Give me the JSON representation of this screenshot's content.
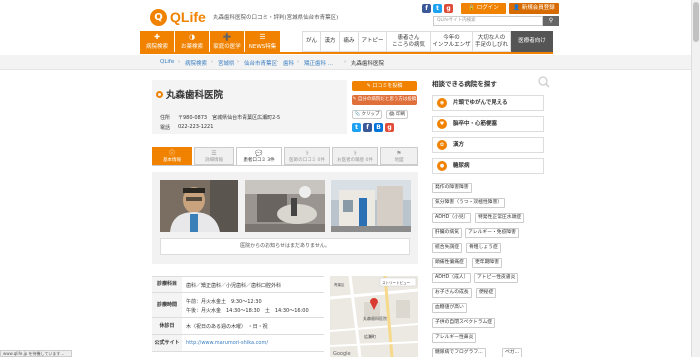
{
  "header": {
    "logo_text": "QLife",
    "logo_mark": "Q",
    "tagline": "丸森歯科医院の口コミ・評判(宮城県仙台市青葉区)",
    "login_label": "ログイン",
    "register_label": "新規会員登録",
    "search_placeholder": "QLifeサイト内検索",
    "search_icon": "search-icon",
    "accent_color": "#f08200"
  },
  "nav": {
    "items": [
      {
        "label": "病院検索",
        "icon": "hospital-icon"
      },
      {
        "label": "お薬検索",
        "icon": "pill-icon"
      },
      {
        "label": "家庭の医学",
        "icon": "cross-icon"
      },
      {
        "label": "NEWS特集",
        "icon": "news-icon"
      },
      {
        "label": "がん"
      },
      {
        "label": "漢方"
      },
      {
        "label": "痛み"
      },
      {
        "label": "アトピー"
      },
      {
        "label": "患者さん",
        "label2": "こころの病気"
      },
      {
        "label": "今年の",
        "label2": "インフルエンザ"
      },
      {
        "label": "大切な人の",
        "label2": "手足のしびれ"
      },
      {
        "label": "医療者向け"
      }
    ]
  },
  "breadcrumb": [
    "QLife",
    "病院検索",
    "宮城県",
    "仙台市青葉区",
    "歯科",
    "矯正歯科 ..."
  ],
  "breadcrumb_current": "丸森歯科医院",
  "clinic": {
    "name": "丸森歯科医院",
    "address_label": "住所",
    "address": "〒980-0873　宮城県仙台市青葉区広瀬町2-5",
    "phone_label": "電話",
    "phone": "022-223-1221",
    "post_review": "口コミを投稿",
    "add_photo": "自分の病院だと思う方は投稿",
    "clip": "クリップ",
    "print": "印刷"
  },
  "tabs": [
    {
      "label": "基本情報"
    },
    {
      "label": "詳細情報"
    },
    {
      "label": "患者口コミ 3件"
    },
    {
      "label": "医師の口コミ 0件"
    },
    {
      "label": "お医者の職歴 0件"
    },
    {
      "label": "地図"
    }
  ],
  "notice": "医院からのお知らせはまだありません。",
  "details": [
    {
      "label": "診療科目",
      "lines": [
        "歯科／矯正歯科／小児歯科／歯科口腔外科"
      ]
    },
    {
      "label": "診療時間",
      "lines": [
        "午前：月火水金土　9:30〜12:30",
        "午後：月火水金　14:30〜18:30　土　14:30〜16:00"
      ]
    },
    {
      "label": "休診日",
      "lines": [
        "木（祝日のある週の木曜） ・日・祝"
      ]
    },
    {
      "label": "公式サイト",
      "lines": [
        "http://www.marumori-shika.com/"
      ]
    }
  ],
  "map": {
    "labels": [
      "広瀬町",
      "青葉区",
      "丸森歯科医院",
      "ストリートビュー",
      "Google"
    ]
  },
  "sidebar": {
    "heading": "相談できる病院を探す",
    "buttons": [
      {
        "label": "片頭でゆがんで見える",
        "icon": "eye-icon"
      },
      {
        "label": "脳卒中・心筋梗塞",
        "icon": "heart-icon"
      },
      {
        "label": "漢方",
        "icon": "herb-icon"
      },
      {
        "label": "糖尿病",
        "icon": "drop-icon"
      }
    ],
    "tags": [
      [
        "発作の障害障害"
      ],
      [
        "気分障害（うつ・双極性障害）"
      ],
      [
        "ADHD（小児）",
        "特発性正常圧水頭症"
      ],
      [
        "肝臓の病気",
        "アレルギー・免疫障害"
      ],
      [
        "統合失調症",
        "骨粗しょう症"
      ],
      [
        "頭痛性偏痛症",
        "更年期障害"
      ],
      [
        "ADHD（成人）",
        "アトピー性皮膚炎"
      ],
      [
        "お子さんの成長",
        "便秘症"
      ],
      [
        "血糖値が高い"
      ],
      [
        "子供の自閉スペクトラム症"
      ],
      [
        "アレルギー性鼻炎"
      ],
      [
        "糖尿病でフログラフ...",
        "ペガ..."
      ]
    ]
  },
  "status_bar": "www.qlife.jp を待機しています..."
}
